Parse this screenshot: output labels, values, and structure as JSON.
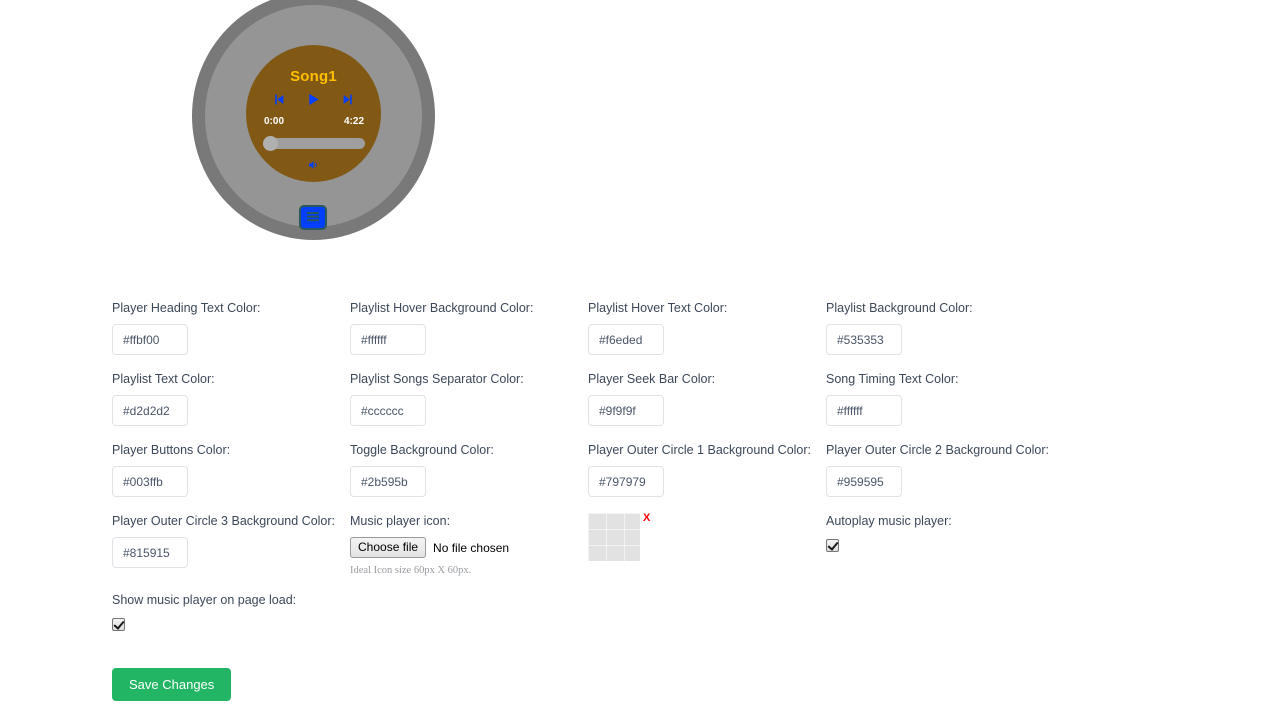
{
  "player_preview": {
    "song_title": "Song1",
    "time_current": "0:00",
    "time_total": "4:22",
    "seek_progress_percent": 0,
    "icons": {
      "previous": "skip-back-icon",
      "play": "play-icon",
      "next": "skip-forward-icon",
      "volume": "volume-icon",
      "toggle": "playlist-toggle-icon"
    },
    "colors": {
      "heading_text": "#ffbf00",
      "buttons": "#003ffb",
      "seek_bar": "#9f9f9f",
      "timing_text": "#ffffff",
      "outer_circle_1": "#797979",
      "outer_circle_2": "#959595",
      "outer_circle_3": "#815915",
      "toggle_background": "#2b595b"
    }
  },
  "form": {
    "fields": [
      {
        "label": "Player Heading Text Color:",
        "value": "#ffbf00"
      },
      {
        "label": "Playlist Hover Background Color:",
        "value": "#ffffff"
      },
      {
        "label": "Playlist Hover Text Color:",
        "value": "#f6eded"
      },
      {
        "label": "Playlist Background Color:",
        "value": "#535353"
      },
      {
        "label": "Playlist Text Color:",
        "value": "#d2d2d2"
      },
      {
        "label": "Playlist Songs Separator Color:",
        "value": "#cccccc"
      },
      {
        "label": "Player Seek Bar Color:",
        "value": "#9f9f9f"
      },
      {
        "label": "Song Timing Text Color:",
        "value": "#ffffff"
      },
      {
        "label": "Player Buttons Color:",
        "value": "#003ffb"
      },
      {
        "label": "Toggle Background Color:",
        "value": "#2b595b"
      },
      {
        "label": "Player Outer Circle 1 Background Color:",
        "value": "#797979"
      },
      {
        "label": "Player Outer Circle 2 Background Color:",
        "value": "#959595"
      },
      {
        "label": "Player Outer Circle 3 Background Color:",
        "value": "#815915"
      }
    ],
    "icon_upload": {
      "label": "Music player icon:",
      "button_label": "Choose file",
      "file_status": "No file chosen",
      "help_text": "Ideal Icon size 60px X 60px.",
      "remove_label": "X"
    },
    "autoplay": {
      "label": "Autoplay music player:",
      "checked": true
    },
    "show_on_load": {
      "label": "Show music player on page load:",
      "checked": true
    },
    "save_label": "Save Changes"
  }
}
